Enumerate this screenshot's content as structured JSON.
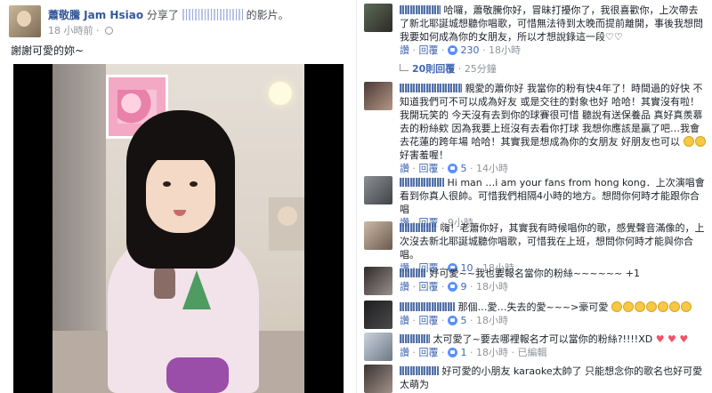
{
  "post": {
    "author": "蕭敬騰 Jam Hsiao",
    "shared_text": "分享了",
    "shared_suffix": "的影片。",
    "time": "18 小時前",
    "separator": "·",
    "text": "謝謝可愛的妳~"
  },
  "comments": [
    {
      "name": "TALLI",
      "text": "哈囉，蕭敬騰你好，冒昧打擾你了，我很喜歡你，上次帶去了新北耶誕城想聽你唱歌，可惜無法待到太晚而提前離開，事後我想問我要如何成為你的女朋友，所以才想說錄這一段♡♡",
      "reply": "讚",
      "respond": "回覆",
      "likes": "230",
      "time": "18小時"
    },
    {
      "name": "Hantahnen Yun",
      "text": "親愛的蕭你好 我當你的粉有快4年了！時間過的好快 不知道我們可不可以成為好友 或是交往的對象也好 哈哈！其實沒有啦！我開玩笑的 今天沒有去到你的球賽很可惜 聽說有送保養品 真好真羨慕去的粉絲欸 因為我要上班沒有去看你打球 我想你應該是贏了吧…我會去花蓮的跨年場 哈哈！其實我是想成為你的女朋友 好朋友也可以",
      "text_tail": "好害羞喔！",
      "reply": "讚",
      "respond": "回覆",
      "likes": "5",
      "time": "14小時"
    },
    {
      "name": "Li Ka Yeung",
      "text": "Hi man …i am your fans from hong kong．上次演唱會看到你真人很帥。可惜我們相隔4小時的地方。想問你何時才能跟你合唱",
      "reply": "讚",
      "respond": "回覆",
      "time": "9小時"
    },
    {
      "name": "Wad Tiny",
      "text": "嗨！老蕭你好，其實我有時候唱你的歌，感覺聲音滿像的，上次沒去新北耶誕城聽你唱歌，可惜我在上班，想問你何時才能與你合唱。",
      "reply": "讚",
      "respond": "回覆",
      "likes": "10",
      "time": "18小時"
    },
    {
      "name": "NaWaN",
      "text": "好可愛~~我也要報名當你的粉絲~~~~~~ +1",
      "reply": "讚",
      "respond": "回覆",
      "likes": "9",
      "time": "18小時"
    },
    {
      "name": "Jasmine Yu",
      "text": "那個…愛…失去的愛~~~>豪可愛",
      "reply": "讚",
      "respond": "回覆",
      "likes": "5",
      "time": "18小時"
    },
    {
      "name": "Ni",
      "text": "太可愛了~要去哪裡報名才可以當你的粉絲?!!!!XD",
      "reply": "讚",
      "respond": "回覆",
      "likes": "1",
      "time": "18小時",
      "edited": "已編輯"
    },
    {
      "name": "Ruslin Xu",
      "text": "好可愛的小朋友 karaoke太帥了 只能想念你的歌名也好可愛 太萌为"
    }
  ],
  "reply_link": {
    "count_label": "20則回覆",
    "time": "25分鐘"
  },
  "colors": {
    "link": "#365899",
    "meta": "#90949c",
    "like": "#5890ff"
  }
}
